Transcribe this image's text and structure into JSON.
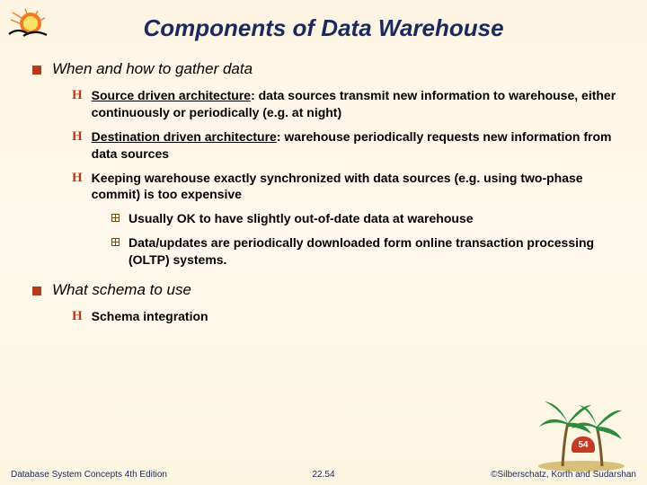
{
  "title": "Components of Data Warehouse",
  "b1": {
    "h": "When and how to gather data",
    "s1_u": "Source driven architecture",
    "s1_r": ": data sources transmit new information to warehouse, either continuously or periodically (e.g. at night)",
    "s2_u": "Destination driven architecture",
    "s2_r": ": warehouse periodically requests new information from data sources",
    "s3": "Keeping warehouse exactly synchronized with data sources (e.g. using two-phase commit) is too expensive",
    "s3a": "Usually OK to have slightly out-of-date data at warehouse",
    "s3b": "Data/updates are periodically downloaded form online transaction processing (OLTP) systems."
  },
  "b2": {
    "h": "What schema to use",
    "s1": "Schema integration"
  },
  "pagebadge": "54",
  "footer": {
    "left": "Database System Concepts 4th Edition",
    "center": "22.54",
    "right": "©Silberschatz, Korth and Sudarshan"
  }
}
